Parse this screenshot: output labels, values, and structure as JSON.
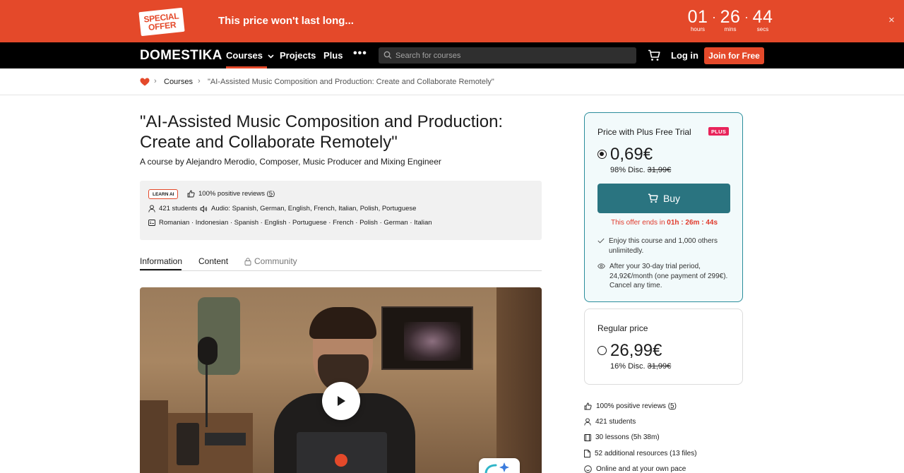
{
  "promo": {
    "logo_line1": "SPECIAL",
    "logo_line2": "OFFER",
    "text": "This price won't last long...",
    "countdown": [
      {
        "value": "01",
        "label": "hours"
      },
      {
        "value": "26",
        "label": "mins"
      },
      {
        "value": "44",
        "label": "secs"
      }
    ],
    "close": "×"
  },
  "nav": {
    "brand": "DOMESTIKA",
    "courses": "Courses",
    "projects": "Projects",
    "plus": "Plus",
    "more": "•••",
    "search_placeholder": "Search for courses",
    "login": "Log in",
    "join": "Join for Free"
  },
  "breadcrumb": {
    "courses": "Courses",
    "current": "\"AI-Assisted Music Composition and Production: Create and Collaborate Remotely\""
  },
  "course": {
    "title": "\"AI-Assisted Music Composition and Production: Create and Collaborate Remotely\"",
    "by_prefix": "A course by ",
    "author": "Alejandro Merodio",
    "author_role": ", Composer, Music Producer and Mixing Engineer"
  },
  "info": {
    "badge": "LEARN AI",
    "reviews_text": "100% positive reviews (",
    "reviews_count": "5",
    "reviews_close": ")",
    "students": "421 students",
    "audio": "Audio: Spanish, German, English, French, Italian, Polish, Portuguese",
    "subtitles": "Romanian · Indonesian · Spanish · English · Portuguese · French · Polish · German · Italian"
  },
  "tabs": {
    "information": "Information",
    "content": "Content",
    "community": "Community"
  },
  "plus_card": {
    "label": "Price with Plus Free Trial",
    "badge": "PLUS",
    "price": "0,69€",
    "discount": "98% Disc. ",
    "original": "31,99€",
    "buy": "Buy",
    "offer_prefix": "This offer ends in ",
    "offer_time": "01h : 26m : 44s",
    "feature_1": "Enjoy this course and 1,000 others unlimitedly.",
    "feature_2": "After your 30-day trial period, 24,92€/month (one payment of 299€). Cancel any time."
  },
  "regular_card": {
    "label": "Regular price",
    "price": "26,99€",
    "discount": "16% Disc. ",
    "original": "31,99€"
  },
  "stats": {
    "reviews_text": "100% positive reviews (",
    "reviews_count": "5",
    "reviews_close": ")",
    "students": "421 students",
    "lessons": "30 lessons (5h 38m)",
    "resources": "52 additional resources (13 files)",
    "online": "Online and at your own pace"
  },
  "colors": {
    "brand": "#e4492a",
    "buy": "#2a7480",
    "plus_badge": "#e8245a"
  }
}
